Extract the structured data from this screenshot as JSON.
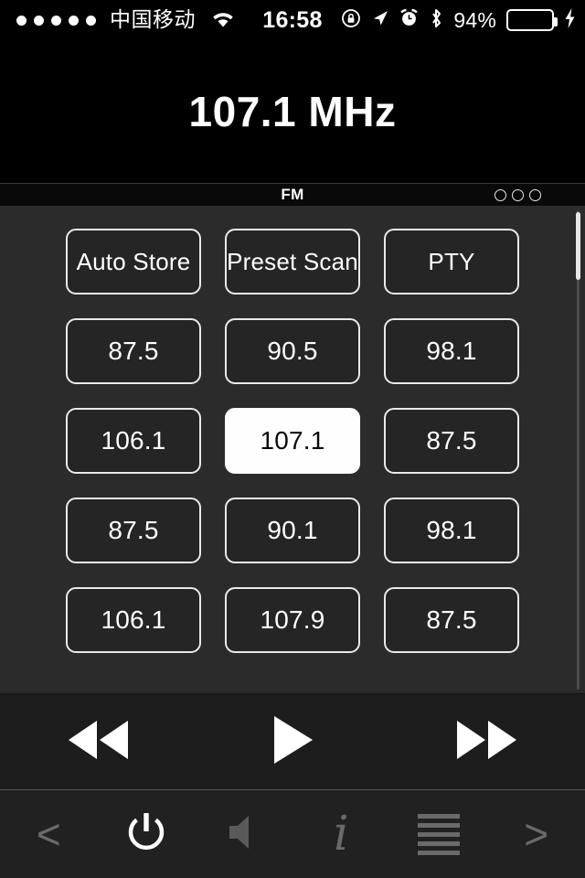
{
  "status_bar": {
    "signal_dots": 5,
    "carrier": "中国移动",
    "wifi_icon": "wifi-icon",
    "time": "16:58",
    "rotation_lock_icon": "rotation-lock-icon",
    "location_icon": "location-arrow-icon",
    "alarm_icon": "alarm-clock-icon",
    "bluetooth_icon": "bluetooth-icon",
    "battery_percent": "94%",
    "battery_level": 94,
    "battery_color": "#3ddc5a",
    "charging_icon": "lightning-bolt-icon"
  },
  "display": {
    "frequency": "107.1 MHz"
  },
  "band_bar": {
    "band": "FM",
    "page_dots": 3
  },
  "presets": {
    "function_buttons": [
      {
        "label": "Auto Store",
        "name": "auto-store-button"
      },
      {
        "label": "Preset Scan",
        "name": "preset-scan-button"
      },
      {
        "label": "PTY",
        "name": "pty-button"
      }
    ],
    "stations": [
      {
        "label": "87.5",
        "active": false
      },
      {
        "label": "90.5",
        "active": false
      },
      {
        "label": "98.1",
        "active": false
      },
      {
        "label": "106.1",
        "active": false
      },
      {
        "label": "107.1",
        "active": true
      },
      {
        "label": "87.5",
        "active": false
      },
      {
        "label": "87.5",
        "active": false
      },
      {
        "label": "90.1",
        "active": false
      },
      {
        "label": "98.1",
        "active": false
      },
      {
        "label": "106.1",
        "active": false
      },
      {
        "label": "107.9",
        "active": false
      },
      {
        "label": "87.5",
        "active": false
      }
    ],
    "active_station": "107.1",
    "scrollbar_position": "top"
  },
  "transport": {
    "previous_icon": "rewind-icon",
    "play_icon": "play-icon",
    "next_icon": "fast-forward-icon"
  },
  "toolbar": {
    "items": [
      {
        "name": "back-chevron-icon",
        "glyph": "<",
        "active": false
      },
      {
        "name": "power-icon",
        "glyph": "",
        "active": true
      },
      {
        "name": "mute-speaker-icon",
        "glyph": "",
        "active": false
      },
      {
        "name": "info-icon",
        "glyph": "i",
        "active": false
      },
      {
        "name": "list-menu-icon",
        "glyph": "",
        "active": false
      },
      {
        "name": "forward-chevron-icon",
        "glyph": ">",
        "active": false
      }
    ]
  },
  "colors": {
    "background": "#000000",
    "panel": "#2b2b2b",
    "button_fill": "#252525",
    "button_border": "#e9e9e9",
    "active_fill": "#fefefe",
    "toolbar": "#212121",
    "icon_dim": "#6a6a6a",
    "icon_active": "#ffffff"
  }
}
